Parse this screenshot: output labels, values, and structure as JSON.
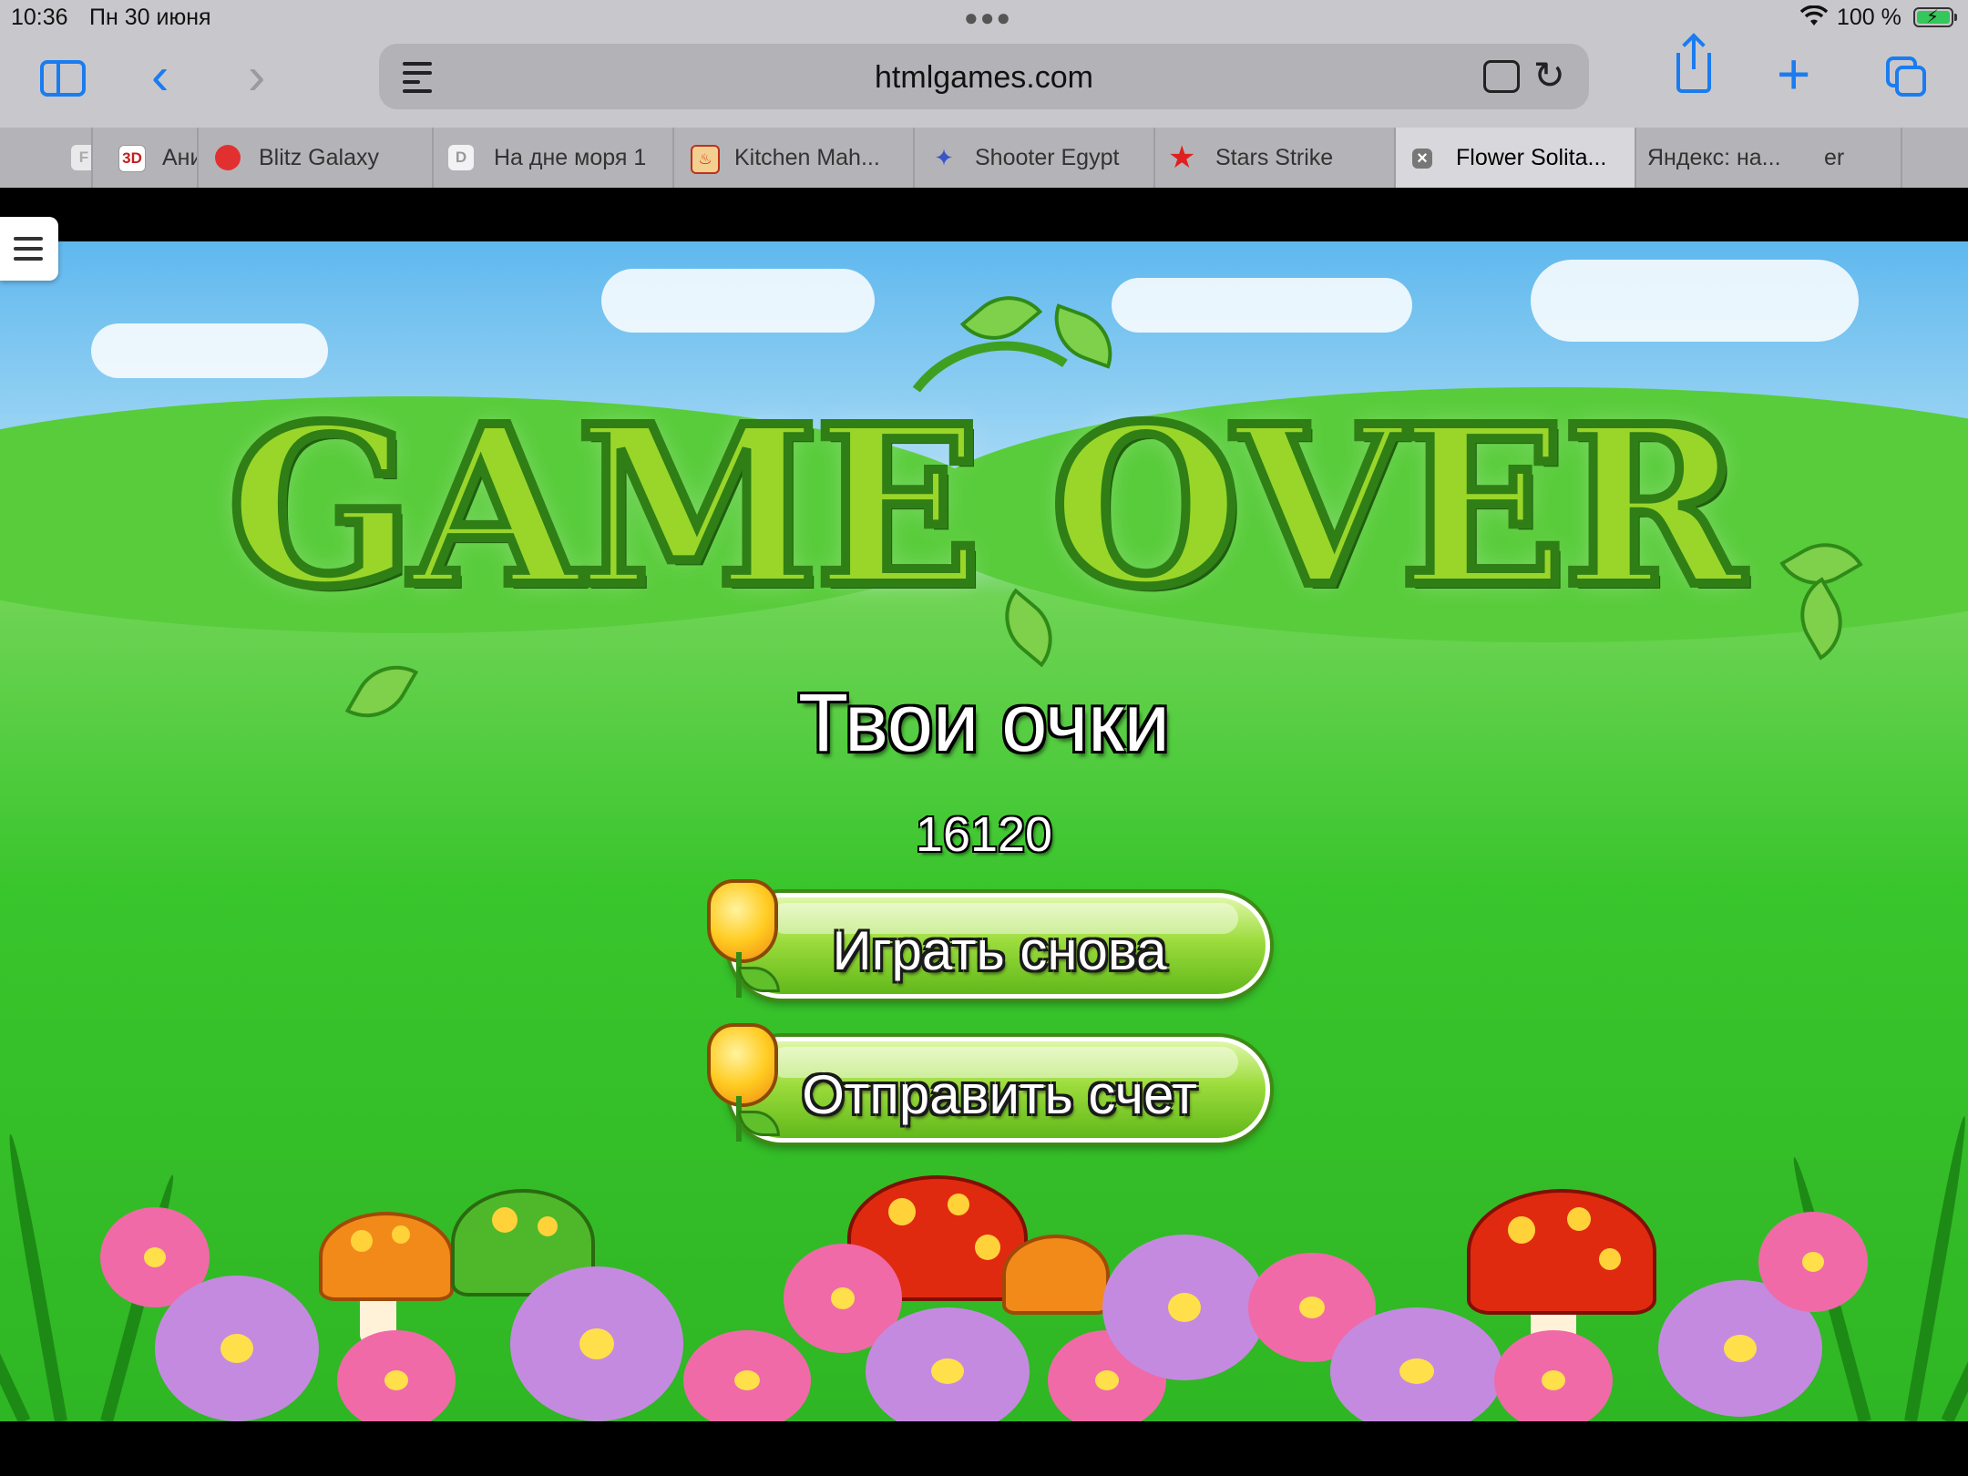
{
  "status": {
    "time": "10:36",
    "date": "Пн 30 июня",
    "battery": "100 %"
  },
  "toolbar": {
    "url": "htmlgames.com"
  },
  "tabs": [
    {
      "label": "",
      "favicon": "F",
      "color": "#e9e9ec"
    },
    {
      "label": "Ани",
      "favicon": "3D",
      "color": "#ffffff"
    },
    {
      "label": "Blitz Galaxy",
      "favicon": "●",
      "color": "#e23030"
    },
    {
      "label": "На дне моря 1",
      "favicon": "D",
      "color": "#e9e9ec"
    },
    {
      "label": "Kitchen Mah...",
      "favicon": "♨",
      "color": "#d8502a"
    },
    {
      "label": "Shooter Egypt",
      "favicon": "✦",
      "color": "#3a55c8"
    },
    {
      "label": "Stars Strike",
      "favicon": "★",
      "color": "#e02020"
    },
    {
      "label": "Flower Solita...",
      "favicon": "×",
      "color": "#777777"
    },
    {
      "label": "Яндекс: на...",
      "favicon": "",
      "color": "#b4b4b8"
    },
    {
      "label": "er",
      "favicon": "",
      "color": "#b4b4b8"
    }
  ],
  "game": {
    "heading": "GAME OVER",
    "score_title": "Твои очки",
    "score": "16120",
    "play_again": "Играть снова",
    "submit_score": "Отправить счет"
  },
  "colors": {
    "safari_blue": "#1a7cf0",
    "grass_green": "#39c52c",
    "button_green": "#9cdc3c"
  }
}
